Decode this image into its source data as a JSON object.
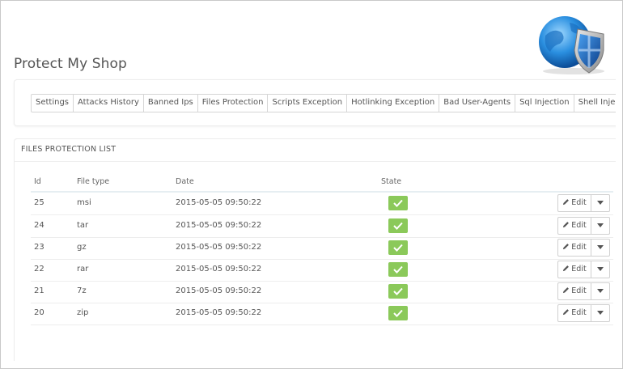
{
  "app": {
    "title": "Protect My Shop"
  },
  "tabs": [
    {
      "label": "Settings"
    },
    {
      "label": "Attacks History"
    },
    {
      "label": "Banned Ips"
    },
    {
      "label": "Files Protection"
    },
    {
      "label": "Scripts Exception"
    },
    {
      "label": "Hotlinking Exception"
    },
    {
      "label": "Bad User-Agents"
    },
    {
      "label": "Sql Injection"
    },
    {
      "label": "Shell Injection"
    }
  ],
  "list": {
    "title": "FILES PROTECTION LIST",
    "columns": {
      "id": "Id",
      "file_type": "File type",
      "date": "Date",
      "state": "State"
    },
    "rows": [
      {
        "id": "25",
        "file_type": "msi",
        "date": "2015-05-05 09:50:22",
        "state": "enabled",
        "edit_label": "Edit"
      },
      {
        "id": "24",
        "file_type": "tar",
        "date": "2015-05-05 09:50:22",
        "state": "enabled",
        "edit_label": "Edit"
      },
      {
        "id": "23",
        "file_type": "gz",
        "date": "2015-05-05 09:50:22",
        "state": "enabled",
        "edit_label": "Edit"
      },
      {
        "id": "22",
        "file_type": "rar",
        "date": "2015-05-05 09:50:22",
        "state": "enabled",
        "edit_label": "Edit"
      },
      {
        "id": "21",
        "file_type": "7z",
        "date": "2015-05-05 09:50:22",
        "state": "enabled",
        "edit_label": "Edit"
      },
      {
        "id": "20",
        "file_type": "zip",
        "date": "2015-05-05 09:50:22",
        "state": "enabled",
        "edit_label": "Edit"
      }
    ]
  },
  "icons": {
    "logo": "globe-shield-icon",
    "state": "check-icon",
    "edit": "pencil-icon",
    "dropdown": "caret-down-icon"
  },
  "colors": {
    "state_enabled": "#8bc95a",
    "logo_shield": "#1e63b8",
    "logo_globe": "#2a8fe0"
  }
}
